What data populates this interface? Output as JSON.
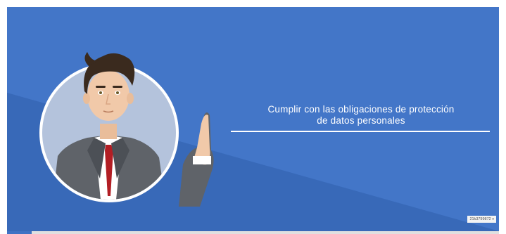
{
  "video": {
    "caption_line_1": "Cumplir con las obligaciones de protección",
    "caption_line_2": "de datos personales",
    "watermark": "21k3799872 v"
  },
  "colors": {
    "background_blue": "#3f72c4",
    "diagonal_blue": "#3a69b5",
    "circle_fill": "#b4c3dc",
    "suit": "#5f6369",
    "tie": "#b21e24",
    "skin": "#f1c9a9",
    "hair": "#3a2a1e"
  },
  "icons": [
    "presenter-avatar-illustration"
  ],
  "progress": {
    "fraction": 0.05
  }
}
